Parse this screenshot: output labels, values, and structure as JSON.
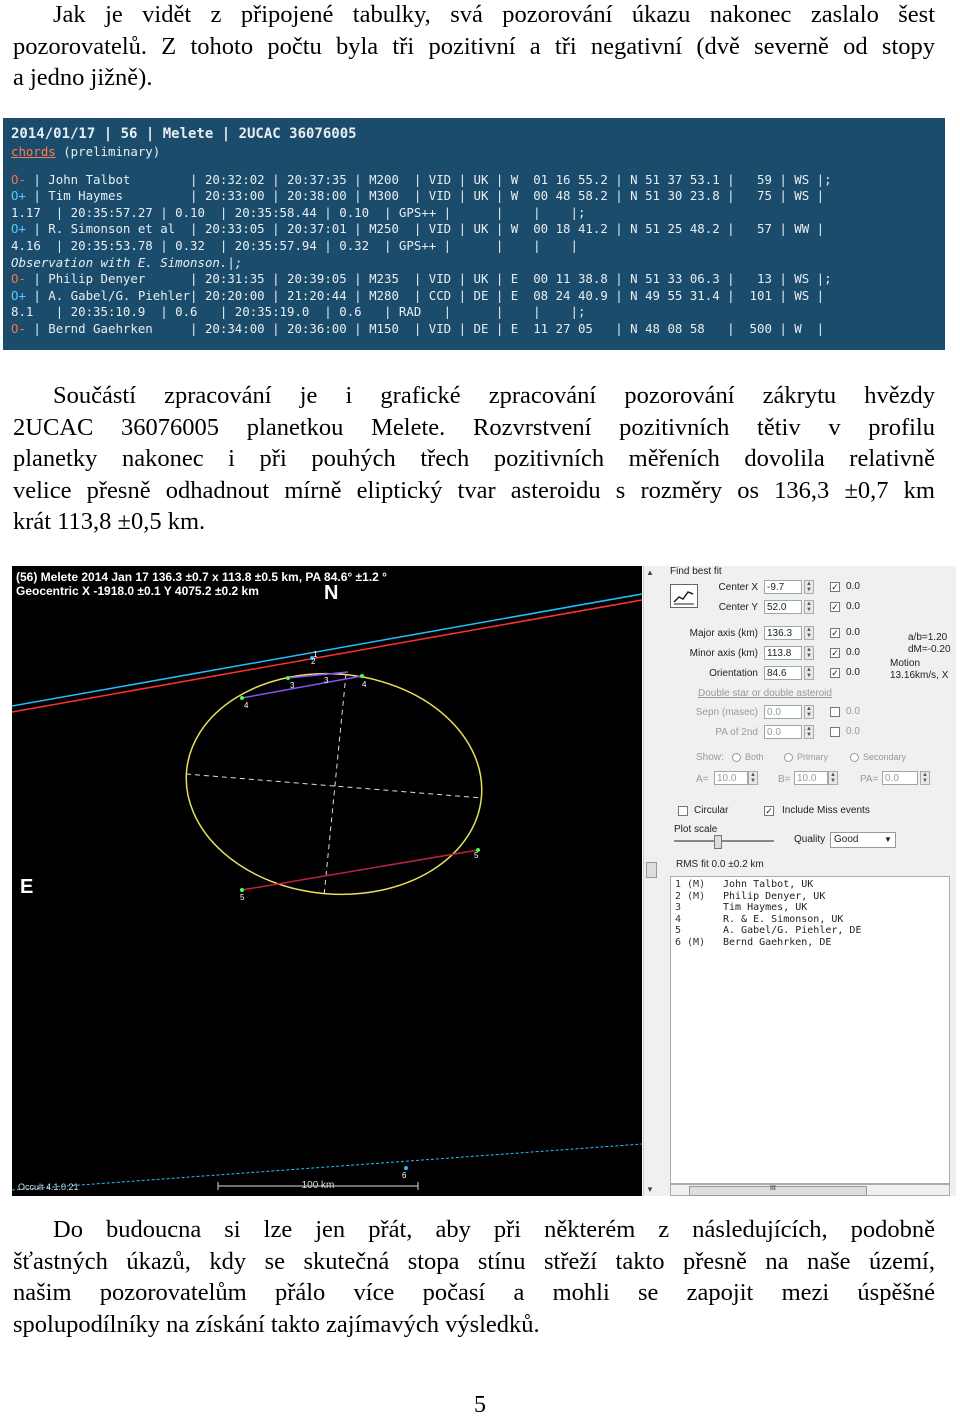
{
  "intro": {
    "lines": [
      "Jak je vidět z připojené tabulky, svá pozorování úkazu nakonec zaslalo šest",
      "pozorovatelů. Z tohoto počtu byla tři pozitivní a tři negativní (dvě severně od stopy",
      "a jedno jižně)."
    ]
  },
  "terminal": {
    "header": "2014/01/17 | 56 | Melete | 2UCAC 36076005",
    "chords_link": "chords",
    "chords_note": " (preliminary)",
    "rows": [
      {
        "mark": "O-",
        "text": " | John Talbot        | 20:32:02 | 20:37:35 | M200  | VID | UK | W  01 16 55.2 | N 51 37 53.1 |   59 | WS |;"
      },
      {
        "mark": "O+",
        "text": " | Tim Haymes         | 20:33:00 | 20:38:00 | M300  | VID | UK | W  00 48 58.2 | N 51 30 23.8 |   75 | WS |"
      },
      {
        "mark": "",
        "text": "1.17  | 20:35:57.27 | 0.10  | 20:35:58.44 | 0.10  | GPS++ |      |    |    |;"
      },
      {
        "mark": "O+",
        "text": " | R. Simonson et al  | 20:33:05 | 20:37:01 | M250  | VID | UK | W  00 18 41.2 | N 51 25 48.2 |   57 | WW |"
      },
      {
        "mark": "",
        "text": "4.16  | 20:35:53.78 | 0.32  | 20:35:57.94 | 0.32  | GPS++ |      |    |    |"
      },
      {
        "mark": "",
        "text": "Observation with E. Simonson.|;",
        "obs": true
      },
      {
        "mark": "O-",
        "text": " | Philip Denyer      | 20:31:35 | 20:39:05 | M235  | VID | UK | E  00 11 38.8 | N 51 33 06.3 |   13 | WS |;"
      },
      {
        "mark": "O+",
        "text": " | A. Gabel/G. Piehler| 20:20:00 | 21:20:44 | M280  | CCD | DE | E  08 24 40.9 | N 49 55 31.4 |  101 | WS |"
      },
      {
        "mark": "",
        "text": "8.1   | 20:35:10.9  | 0.6   | 20:35:19.0  | 0.6   | RAD   |      |    |    |;"
      },
      {
        "mark": "O-",
        "text": " | Bernd Gaehrken     | 20:34:00 | 20:36:00 | M150  | VID | DE | E  11 27 05   | N 48 08 58   |  500 | W  |"
      }
    ]
  },
  "middle": {
    "lines": [
      "Součástí zpracování je i grafické zpracování pozorování zákrytu hvězdy",
      "2UCAC 36076005 planetkou Melete. Rozvrstvení pozitivních tětiv v profilu",
      "planetky nakonec i při pouhých třech pozitivních měřeních dovolila relativně",
      "velice přesně odhadnout mírně eliptický tvar asteroidu s rozměry os 136,3 ±0,7 km",
      "krát 113,8 ±0,5 km."
    ]
  },
  "plot": {
    "info_line1": "(56) Melete  2014 Jan 17   136.3 ±0.7 x 113.8 ±0.5 km, PA 84.6° ±1.2 °",
    "info_line2": "Geocentric X  -1918.0 ±0.1  Y 4075.2 ±0.2 km",
    "north": "N",
    "east": "E",
    "version": "Occult 4.1.0.21",
    "scale": "100 km",
    "chord_labels": [
      "2",
      "1",
      "3",
      "4",
      "3",
      "4",
      "5",
      "5",
      "6"
    ],
    "colors": {
      "background": "#000000",
      "ellipse": "#e6e05a",
      "north_line": "#ff3030",
      "south_line": "#20c0ff",
      "chord": "#8a4fff",
      "miss": "#c02040"
    }
  },
  "panel": {
    "title": "Find best fit",
    "center_x_label": "Center X",
    "center_x": "-9.7",
    "center_y_label": "Center Y",
    "center_y": "52.0",
    "major_label": "Major axis (km)",
    "major": "136.3",
    "minor_label": "Minor axis (km)",
    "minor": "113.8",
    "orient_label": "Orientation",
    "orient": "84.6",
    "check_vals": [
      "0.0",
      "0.0",
      "0.0",
      "0.0",
      "0.0",
      "0.0",
      "0.0"
    ],
    "ratio": "a/b=1.20",
    "dm": "dM=-0.20",
    "motion_label": "Motion",
    "motion": "13.16km/s, X",
    "double_label": "Double star  or  double asteroid",
    "sepn_label": "Sepn (masec)",
    "sepn": "0.0",
    "pa2_label": "PA of 2nd",
    "pa2": "0.0",
    "show_label": "Show:",
    "both": "Both",
    "primary": "Primary",
    "secondary": "Secondary",
    "a_label": "A=",
    "a_val": "10.0",
    "b_label": "B=",
    "b_val": "10.0",
    "pa_label": "PA=",
    "pa_val": "0.0",
    "circular": "Circular",
    "include_miss": "Include Miss events",
    "plot_scale": "Plot scale",
    "quality_label": "Quality",
    "quality": "Good",
    "rms": "RMS fit 0.0 ±0.2 km",
    "chords": [
      {
        "num": "1 (M)",
        "name": "John Talbot, UK"
      },
      {
        "num": "2 (M)",
        "name": "Philip Denyer, UK"
      },
      {
        "num": "3",
        "name": "Tim Haymes, UK"
      },
      {
        "num": "4",
        "name": "R. & E. Simonson, UK"
      },
      {
        "num": "5",
        "name": "A. Gabel/G. Piehler, DE"
      },
      {
        "num": "6 (M)",
        "name": "Bernd Gaehrken, DE"
      }
    ],
    "hscroll_mark": "III"
  },
  "outro": {
    "lines": [
      "Do budoucna si lze jen přát, aby při některém z následujících, podobně",
      "šťastných úkazů, kdy se skutečná stopa stínu střeží takto přesně na naše území,",
      "našim pozorovatelům přálo více počasí a mohli se zapojit mezi úspěšné",
      "spolupodílníky na získání takto zajímavých výsledků."
    ]
  },
  "page_number": "5"
}
